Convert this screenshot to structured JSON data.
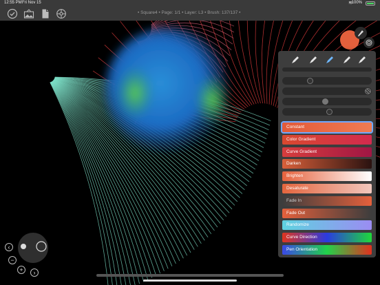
{
  "status_bar": {
    "time": "12:55 PM",
    "date": "Fri Nov 15",
    "battery": "100%"
  },
  "toolbar": {
    "doc_info": "• Square4 • Page: 1/1 • Layer: L3 • Brush: 137/137 •"
  },
  "panel": {
    "brush_icons": [
      "brush-icon",
      "pen-icon",
      "airbrush-icon",
      "marker-icon",
      "eraser-icon"
    ],
    "dynamics": [
      {
        "label": "Constant",
        "grad": "#e25a3a,#ef7b52",
        "selected": true,
        "text_color": "#fff"
      },
      {
        "label": "Color Gradient",
        "grad": "#d8492f,#d32a4e",
        "selected": false,
        "text_color": "#fff"
      },
      {
        "label": "Curve Gradient",
        "grad": "#d73d3d,#a01644",
        "selected": false,
        "text_color": "#fff"
      },
      {
        "label": "Darken",
        "grad": "#d9603a,#2a1210",
        "selected": false,
        "text_color": "#fff"
      },
      {
        "label": "Brighten",
        "grad": "#e6623d,#ffffff",
        "selected": false,
        "text_color": "#fff"
      },
      {
        "label": "Desaturate",
        "grad": "#e4653e,#f1c7bd",
        "selected": false,
        "text_color": "#fff"
      },
      {
        "label": "Fade In",
        "grad": "#3d3d3d,#e4603c",
        "selected": false,
        "text_color": "#ccc"
      },
      {
        "label": "Fade Out",
        "grad": "#e4603c,#3d3d3d",
        "selected": false,
        "text_color": "#fff"
      },
      {
        "label": "Randomize",
        "grad": "#5fd3e0,#9b8cf2",
        "selected": false,
        "text_color": "#fff"
      },
      {
        "label": "Curve Direction",
        "grad": "#e0351f,#2b3be0,#1ed93a",
        "selected": false,
        "text_color": "#fff"
      },
      {
        "label": "Pen Orientation",
        "grad": "#3a49e6,#22d24a,#e2301f",
        "selected": false,
        "text_color": "#fff"
      }
    ]
  },
  "colors": {
    "accent": "#e4603c",
    "selection": "#6fa8ff",
    "panel_bg": "#3d3d3d",
    "toolbar_bg": "#3a3a3a"
  }
}
